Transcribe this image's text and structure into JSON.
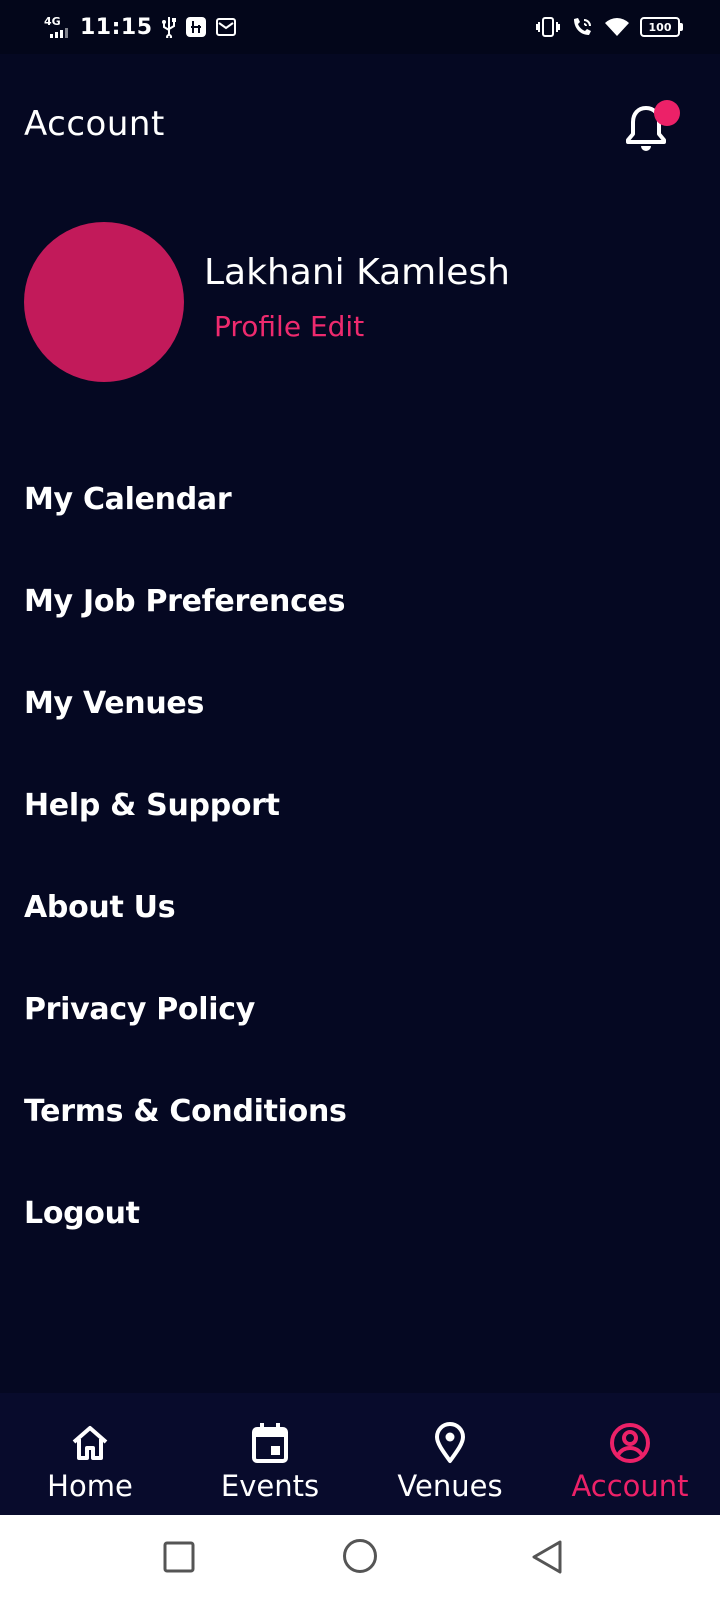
{
  "status_bar": {
    "network": "4G",
    "time": "11:15",
    "battery": "100",
    "icons": [
      "usb-icon",
      "usb-debug-icon",
      "mail-icon",
      "vibrate-icon",
      "wifi-call-icon",
      "wifi-icon",
      "battery-icon"
    ]
  },
  "header": {
    "title": "Account",
    "icon": "bell-icon",
    "notification_dot_color": "#ec2168"
  },
  "profile": {
    "name": "Lakhani Kamlesh",
    "edit_label": "Profile Edit",
    "avatar_color": "#c21a5a"
  },
  "menu": {
    "items": [
      {
        "label": "My Calendar"
      },
      {
        "label": "My Job Preferences"
      },
      {
        "label": "My Venues"
      },
      {
        "label": "Help & Support"
      },
      {
        "label": "About Us"
      },
      {
        "label": "Privacy Policy"
      },
      {
        "label": "Terms & Conditions"
      },
      {
        "label": "Logout"
      }
    ]
  },
  "bottom_nav": {
    "items": [
      {
        "label": "Home",
        "icon": "home-icon"
      },
      {
        "label": "Events",
        "icon": "calendar-icon"
      },
      {
        "label": "Venues",
        "icon": "location-pin-icon"
      },
      {
        "label": "Account",
        "icon": "account-circle-icon",
        "active": true
      }
    ],
    "accent": "#ec2168"
  },
  "colors": {
    "background": "#050822",
    "nav_background": "#080b2c",
    "accent": "#ec2168"
  }
}
